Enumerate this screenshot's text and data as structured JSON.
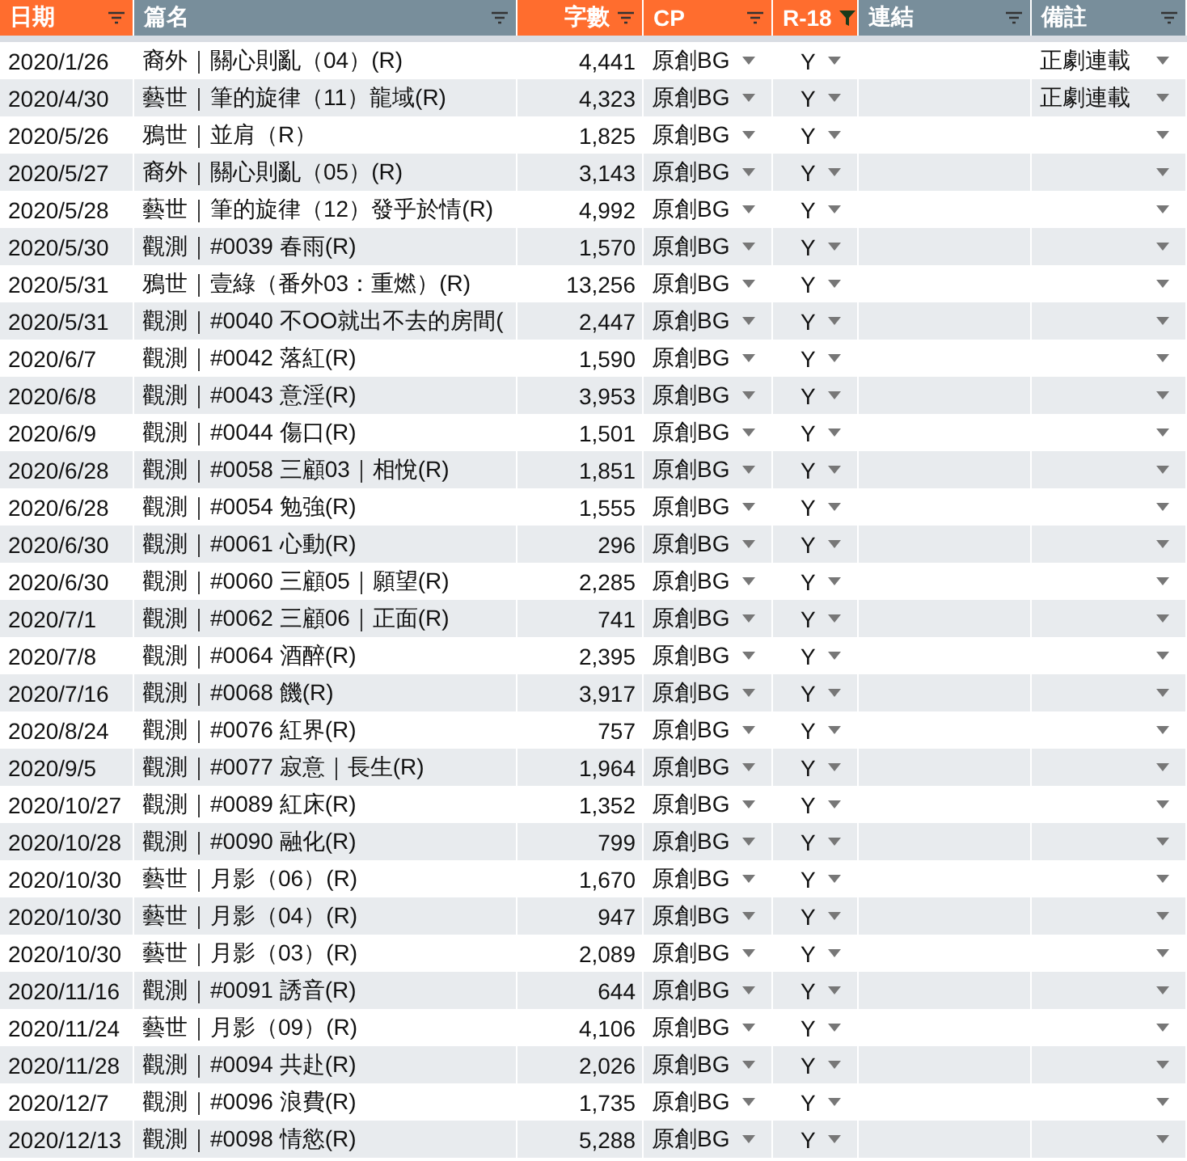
{
  "table": {
    "columns": [
      {
        "label": "日期",
        "color": "#ff6d2e",
        "filtered": false
      },
      {
        "label": "篇名",
        "color": "#788e9b",
        "filtered": false
      },
      {
        "label": "字數",
        "color": "#ff6d2e",
        "filtered": false
      },
      {
        "label": "CP",
        "color": "#ff6d2e",
        "filtered": false
      },
      {
        "label": "R-18",
        "color": "#ff6d2e",
        "filtered": true
      },
      {
        "label": "連結",
        "color": "#788e9b",
        "filtered": false
      },
      {
        "label": "備註",
        "color": "#788e9b",
        "filtered": false
      }
    ],
    "rows": [
      {
        "date": "2020/1/26",
        "title": "裔外｜關心則亂（04）(R)",
        "count": "4,441",
        "cp": "原創BG",
        "r18": "Y",
        "note": "正劇連載"
      },
      {
        "date": "2020/4/30",
        "title": "藝世｜筆的旋律（11）龍域(R)",
        "count": "4,323",
        "cp": "原創BG",
        "r18": "Y",
        "note": "正劇連載"
      },
      {
        "date": "2020/5/26",
        "title": "鴉世｜並肩（R）",
        "count": "1,825",
        "cp": "原創BG",
        "r18": "Y"
      },
      {
        "date": "2020/5/27",
        "title": "裔外｜關心則亂（05）(R)",
        "count": "3,143",
        "cp": "原創BG",
        "r18": "Y"
      },
      {
        "date": "2020/5/28",
        "title": "藝世｜筆的旋律（12）發乎於情(R)",
        "count": "4,992",
        "cp": "原創BG",
        "r18": "Y"
      },
      {
        "date": "2020/5/30",
        "title": "觀測｜#0039 春雨(R)",
        "count": "1,570",
        "cp": "原創BG",
        "r18": "Y"
      },
      {
        "date": "2020/5/31",
        "title": "鴉世｜壹綠（番外03：重燃）(R)",
        "count": "13,256",
        "cp": "原創BG",
        "r18": "Y"
      },
      {
        "date": "2020/5/31",
        "title": "觀測｜#0040 不OO就出不去的房間(",
        "count": "2,447",
        "cp": "原創BG",
        "r18": "Y"
      },
      {
        "date": "2020/6/7",
        "title": "觀測｜#0042 落紅(R)",
        "count": "1,590",
        "cp": "原創BG",
        "r18": "Y"
      },
      {
        "date": "2020/6/8",
        "title": "觀測｜#0043 意淫(R)",
        "count": "3,953",
        "cp": "原創BG",
        "r18": "Y"
      },
      {
        "date": "2020/6/9",
        "title": "觀測｜#0044 傷口(R)",
        "count": "1,501",
        "cp": "原創BG",
        "r18": "Y"
      },
      {
        "date": "2020/6/28",
        "title": "觀測｜#0058 三顧03｜相悅(R)",
        "count": "1,851",
        "cp": "原創BG",
        "r18": "Y"
      },
      {
        "date": "2020/6/28",
        "title": "觀測｜#0054 勉強(R)",
        "count": "1,555",
        "cp": "原創BG",
        "r18": "Y"
      },
      {
        "date": "2020/6/30",
        "title": "觀測｜#0061 心動(R)",
        "count": "296",
        "cp": "原創BG",
        "r18": "Y"
      },
      {
        "date": "2020/6/30",
        "title": "觀測｜#0060 三顧05｜願望(R)",
        "count": "2,285",
        "cp": "原創BG",
        "r18": "Y"
      },
      {
        "date": "2020/7/1",
        "title": "觀測｜#0062 三顧06｜正面(R)",
        "count": "741",
        "cp": "原創BG",
        "r18": "Y"
      },
      {
        "date": "2020/7/8",
        "title": "觀測｜#0064 酒醉(R)",
        "count": "2,395",
        "cp": "原創BG",
        "r18": "Y"
      },
      {
        "date": "2020/7/16",
        "title": "觀測｜#0068 饑(R)",
        "count": "3,917",
        "cp": "原創BG",
        "r18": "Y"
      },
      {
        "date": "2020/8/24",
        "title": "觀測｜#0076 紅界(R)",
        "count": "757",
        "cp": "原創BG",
        "r18": "Y"
      },
      {
        "date": "2020/9/5",
        "title": "觀測｜#0077 寂意｜長生(R)",
        "count": "1,964",
        "cp": "原創BG",
        "r18": "Y"
      },
      {
        "date": "2020/10/27",
        "title": "觀測｜#0089 紅床(R)",
        "count": "1,352",
        "cp": "原創BG",
        "r18": "Y"
      },
      {
        "date": "2020/10/28",
        "title": "觀測｜#0090 融化(R)",
        "count": "799",
        "cp": "原創BG",
        "r18": "Y"
      },
      {
        "date": "2020/10/30",
        "title": "藝世｜月影（06）(R)",
        "count": "1,670",
        "cp": "原創BG",
        "r18": "Y"
      },
      {
        "date": "2020/10/30",
        "title": "藝世｜月影（04）(R)",
        "count": "947",
        "cp": "原創BG",
        "r18": "Y"
      },
      {
        "date": "2020/10/30",
        "title": "藝世｜月影（03）(R)",
        "count": "2,089",
        "cp": "原創BG",
        "r18": "Y"
      },
      {
        "date": "2020/11/16",
        "title": "觀測｜#0091 誘音(R)",
        "count": "644",
        "cp": "原創BG",
        "r18": "Y"
      },
      {
        "date": "2020/11/24",
        "title": "藝世｜月影（09）(R)",
        "count": "4,106",
        "cp": "原創BG",
        "r18": "Y"
      },
      {
        "date": "2020/11/28",
        "title": "觀測｜#0094 共赴(R)",
        "count": "2,026",
        "cp": "原創BG",
        "r18": "Y"
      },
      {
        "date": "2020/12/7",
        "title": "觀測｜#0096 浪費(R)",
        "count": "1,735",
        "cp": "原創BG",
        "r18": "Y"
      },
      {
        "date": "2020/12/13",
        "title": "觀測｜#0098 情慾(R)",
        "count": "5,288",
        "cp": "原創BG",
        "r18": "Y"
      }
    ]
  }
}
